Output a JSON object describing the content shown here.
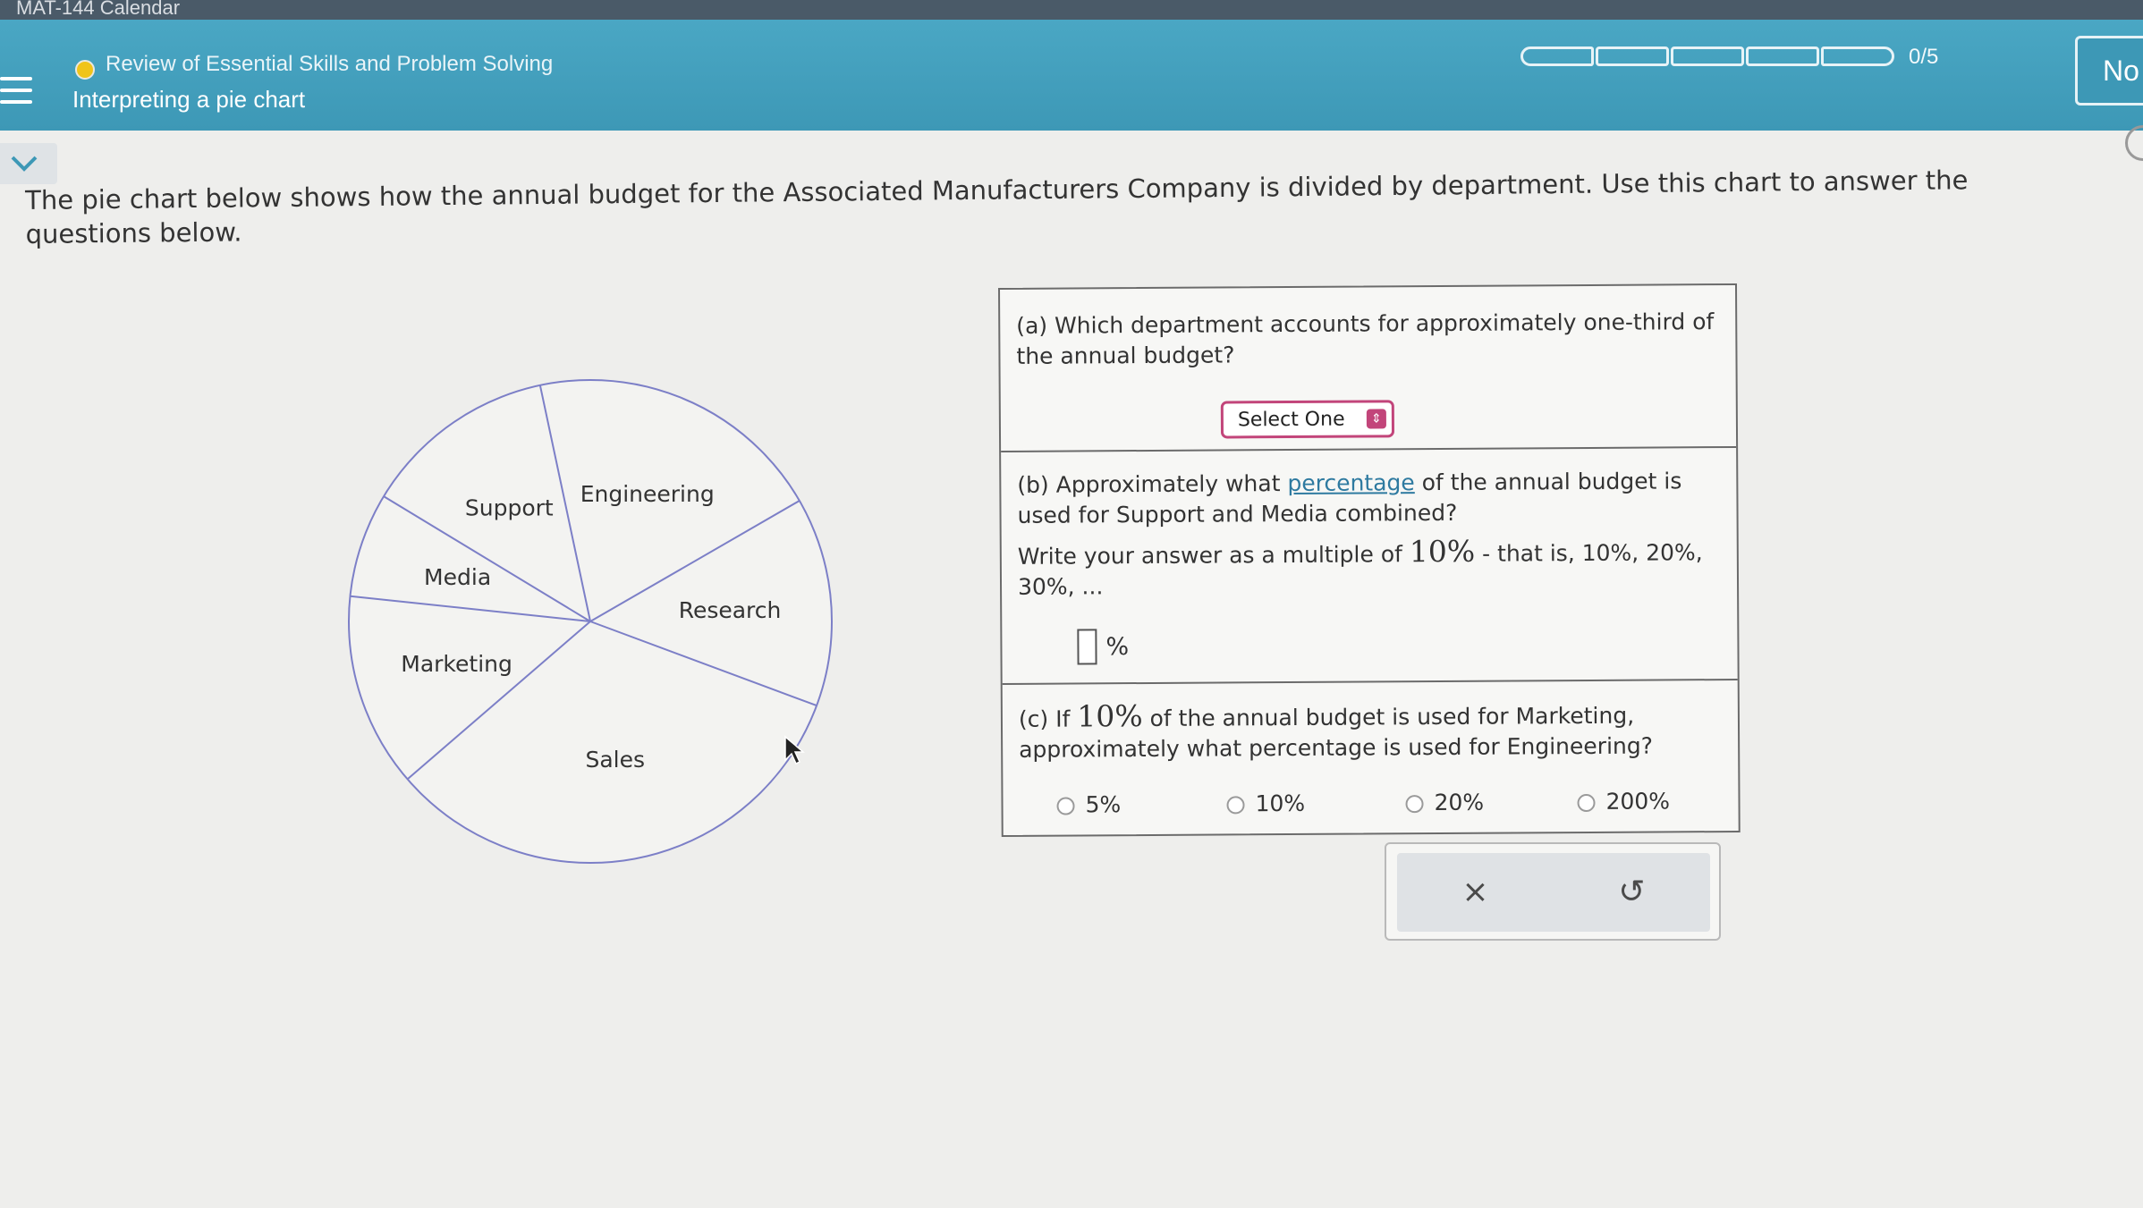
{
  "browser": {
    "tab_title": "MAT-144 Calendar"
  },
  "header": {
    "topic": "Review of Essential Skills and Problem Solving",
    "title": "Interpreting a pie chart",
    "progress_text": "0/5",
    "progress_completed": 0,
    "progress_total": 5,
    "next_label": "No"
  },
  "intro": "The pie chart below shows how the annual budget for the Associated Manufacturers Company is divided by department. Use this chart to answer the questions below.",
  "chart_data": {
    "type": "pie",
    "title": "",
    "slice_labels": [
      "Engineering",
      "Research",
      "Sales",
      "Marketing",
      "Media",
      "Support"
    ],
    "values_percent": [
      20,
      14,
      33,
      13,
      7,
      13
    ]
  },
  "questions": {
    "a": {
      "prompt": "(a) Which department accounts for approximately one-third of the annual budget?",
      "select_label": "Select One"
    },
    "b": {
      "prompt_before_link": "(b) Approximately what ",
      "link_text": "percentage",
      "prompt_after_link": " of the annual budget is used for Support and Media combined?",
      "instruction_before": "Write your answer as a multiple of ",
      "instruction_value": "10%",
      "instruction_after": " - that is, 10%, 20%, 30%, ...",
      "unit": "%"
    },
    "c": {
      "prompt_before": "(c) If ",
      "prompt_value": "10%",
      "prompt_after": " of the annual budget is used for Marketing, approximately what percentage is used for Engineering?",
      "options": [
        "5%",
        "10%",
        "20%",
        "200%"
      ]
    }
  },
  "actions": {
    "clear_symbol": "×",
    "undo_symbol": "↺"
  }
}
